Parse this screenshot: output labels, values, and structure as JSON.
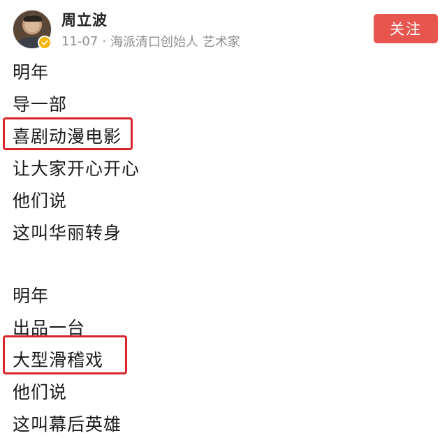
{
  "author": {
    "name": "周立波",
    "date": "11-07",
    "separator": "·",
    "bio": "海派清口创始人 艺术家"
  },
  "actions": {
    "follow_label": "关注"
  },
  "icons": {
    "verified": "verified-badge-icon",
    "verified_color": "#f5b400"
  },
  "colors": {
    "follow_button": "#e6564f",
    "highlight_border": "#d8262c"
  },
  "post": {
    "lines": [
      "明年",
      "导一部",
      "喜剧动漫电影",
      "让大家开心开心",
      "他们说",
      "这叫华丽转身",
      "明年",
      "出品一台",
      "大型滑稽戏",
      "他们说",
      "这叫幕后英雄"
    ],
    "highlighted": [
      "喜剧动漫电影",
      "大型滑稽戏"
    ]
  }
}
